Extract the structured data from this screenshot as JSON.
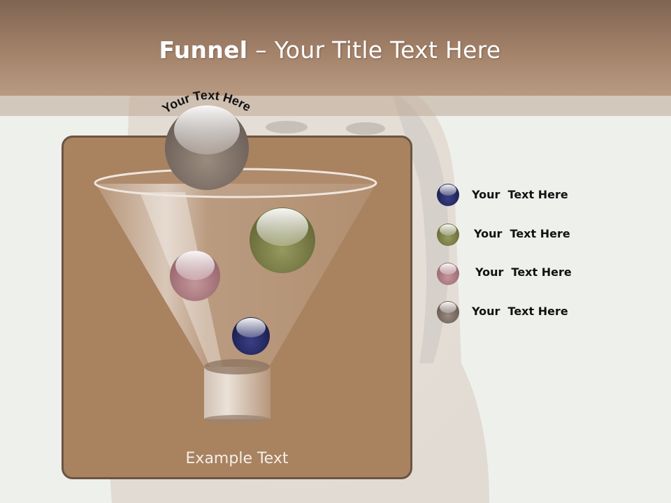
{
  "slide": {
    "title_bold": "Funnel",
    "title_rest": " – Your Title Text Here",
    "top_label": "Your Text Here",
    "caption": "Example Text"
  },
  "legend": [
    {
      "label": "Your  Text Here",
      "color": "#2a2f6a",
      "icon": "navy-sphere-icon"
    },
    {
      "label": "Your  Text Here",
      "color": "#7a7a45",
      "icon": "olive-sphere-icon"
    },
    {
      "label": "Your  Text Here",
      "color": "#b07a82",
      "icon": "rose-sphere-icon"
    },
    {
      "label": "Your  Text Here",
      "color": "#7a6a60",
      "icon": "taupe-sphere-icon"
    }
  ],
  "colors": {
    "header": "#a4826a",
    "panel": "#a98260",
    "panel_border": "#6b5441"
  }
}
